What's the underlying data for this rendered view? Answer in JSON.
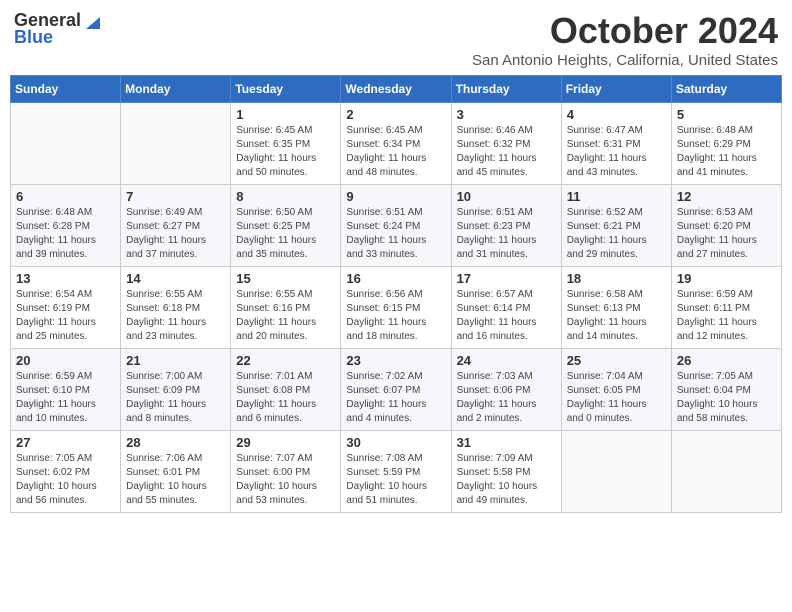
{
  "header": {
    "logo_general": "General",
    "logo_blue": "Blue",
    "month_title": "October 2024",
    "location": "San Antonio Heights, California, United States"
  },
  "calendar": {
    "days_of_week": [
      "Sunday",
      "Monday",
      "Tuesday",
      "Wednesday",
      "Thursday",
      "Friday",
      "Saturday"
    ],
    "weeks": [
      [
        {
          "day": "",
          "info": ""
        },
        {
          "day": "",
          "info": ""
        },
        {
          "day": "1",
          "info": "Sunrise: 6:45 AM\nSunset: 6:35 PM\nDaylight: 11 hours and 50 minutes."
        },
        {
          "day": "2",
          "info": "Sunrise: 6:45 AM\nSunset: 6:34 PM\nDaylight: 11 hours and 48 minutes."
        },
        {
          "day": "3",
          "info": "Sunrise: 6:46 AM\nSunset: 6:32 PM\nDaylight: 11 hours and 45 minutes."
        },
        {
          "day": "4",
          "info": "Sunrise: 6:47 AM\nSunset: 6:31 PM\nDaylight: 11 hours and 43 minutes."
        },
        {
          "day": "5",
          "info": "Sunrise: 6:48 AM\nSunset: 6:29 PM\nDaylight: 11 hours and 41 minutes."
        }
      ],
      [
        {
          "day": "6",
          "info": "Sunrise: 6:48 AM\nSunset: 6:28 PM\nDaylight: 11 hours and 39 minutes."
        },
        {
          "day": "7",
          "info": "Sunrise: 6:49 AM\nSunset: 6:27 PM\nDaylight: 11 hours and 37 minutes."
        },
        {
          "day": "8",
          "info": "Sunrise: 6:50 AM\nSunset: 6:25 PM\nDaylight: 11 hours and 35 minutes."
        },
        {
          "day": "9",
          "info": "Sunrise: 6:51 AM\nSunset: 6:24 PM\nDaylight: 11 hours and 33 minutes."
        },
        {
          "day": "10",
          "info": "Sunrise: 6:51 AM\nSunset: 6:23 PM\nDaylight: 11 hours and 31 minutes."
        },
        {
          "day": "11",
          "info": "Sunrise: 6:52 AM\nSunset: 6:21 PM\nDaylight: 11 hours and 29 minutes."
        },
        {
          "day": "12",
          "info": "Sunrise: 6:53 AM\nSunset: 6:20 PM\nDaylight: 11 hours and 27 minutes."
        }
      ],
      [
        {
          "day": "13",
          "info": "Sunrise: 6:54 AM\nSunset: 6:19 PM\nDaylight: 11 hours and 25 minutes."
        },
        {
          "day": "14",
          "info": "Sunrise: 6:55 AM\nSunset: 6:18 PM\nDaylight: 11 hours and 23 minutes."
        },
        {
          "day": "15",
          "info": "Sunrise: 6:55 AM\nSunset: 6:16 PM\nDaylight: 11 hours and 20 minutes."
        },
        {
          "day": "16",
          "info": "Sunrise: 6:56 AM\nSunset: 6:15 PM\nDaylight: 11 hours and 18 minutes."
        },
        {
          "day": "17",
          "info": "Sunrise: 6:57 AM\nSunset: 6:14 PM\nDaylight: 11 hours and 16 minutes."
        },
        {
          "day": "18",
          "info": "Sunrise: 6:58 AM\nSunset: 6:13 PM\nDaylight: 11 hours and 14 minutes."
        },
        {
          "day": "19",
          "info": "Sunrise: 6:59 AM\nSunset: 6:11 PM\nDaylight: 11 hours and 12 minutes."
        }
      ],
      [
        {
          "day": "20",
          "info": "Sunrise: 6:59 AM\nSunset: 6:10 PM\nDaylight: 11 hours and 10 minutes."
        },
        {
          "day": "21",
          "info": "Sunrise: 7:00 AM\nSunset: 6:09 PM\nDaylight: 11 hours and 8 minutes."
        },
        {
          "day": "22",
          "info": "Sunrise: 7:01 AM\nSunset: 6:08 PM\nDaylight: 11 hours and 6 minutes."
        },
        {
          "day": "23",
          "info": "Sunrise: 7:02 AM\nSunset: 6:07 PM\nDaylight: 11 hours and 4 minutes."
        },
        {
          "day": "24",
          "info": "Sunrise: 7:03 AM\nSunset: 6:06 PM\nDaylight: 11 hours and 2 minutes."
        },
        {
          "day": "25",
          "info": "Sunrise: 7:04 AM\nSunset: 6:05 PM\nDaylight: 11 hours and 0 minutes."
        },
        {
          "day": "26",
          "info": "Sunrise: 7:05 AM\nSunset: 6:04 PM\nDaylight: 10 hours and 58 minutes."
        }
      ],
      [
        {
          "day": "27",
          "info": "Sunrise: 7:05 AM\nSunset: 6:02 PM\nDaylight: 10 hours and 56 minutes."
        },
        {
          "day": "28",
          "info": "Sunrise: 7:06 AM\nSunset: 6:01 PM\nDaylight: 10 hours and 55 minutes."
        },
        {
          "day": "29",
          "info": "Sunrise: 7:07 AM\nSunset: 6:00 PM\nDaylight: 10 hours and 53 minutes."
        },
        {
          "day": "30",
          "info": "Sunrise: 7:08 AM\nSunset: 5:59 PM\nDaylight: 10 hours and 51 minutes."
        },
        {
          "day": "31",
          "info": "Sunrise: 7:09 AM\nSunset: 5:58 PM\nDaylight: 10 hours and 49 minutes."
        },
        {
          "day": "",
          "info": ""
        },
        {
          "day": "",
          "info": ""
        }
      ]
    ]
  }
}
